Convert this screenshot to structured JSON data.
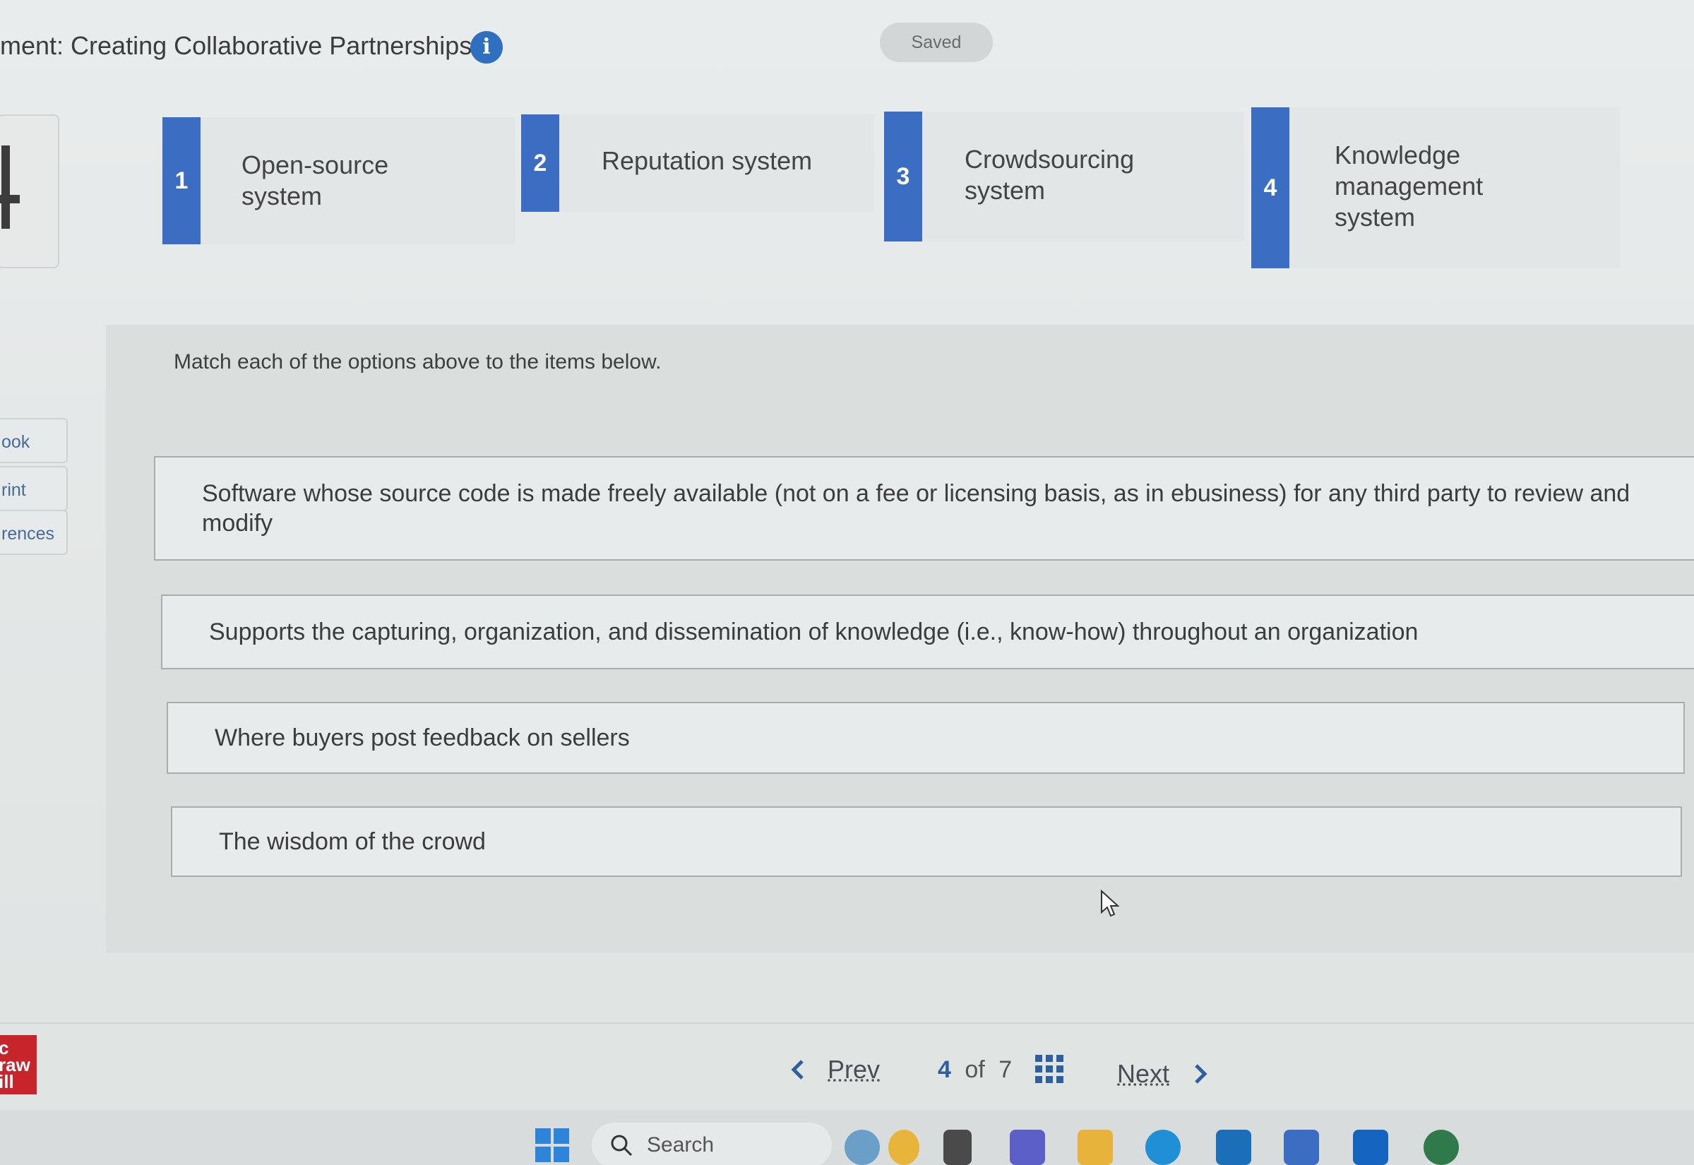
{
  "header": {
    "title": "ment: Creating Collaborative Partnerships",
    "saved_label": "Saved"
  },
  "side_tabs": [
    "ook",
    "rint",
    "rences"
  ],
  "options": [
    {
      "number": "1",
      "label": "Open-source system"
    },
    {
      "number": "2",
      "label": "Reputation system"
    },
    {
      "number": "3",
      "label": "Crowdsourcing system"
    },
    {
      "number": "4",
      "label": "Knowledge management system"
    }
  ],
  "instructions": "Match each of the options above to the items below.",
  "items": [
    "Software whose source code is made freely available (not on a fee or licensing basis, as in ebusiness) for any third party to review and modify",
    "Supports the capturing, organization, and dissemination of knowledge (i.e., know-how) throughout an organization",
    "Where buyers post feedback on sellers",
    "The wisdom of the crowd"
  ],
  "footer": {
    "logo_text": "c\nraw\nill",
    "prev_label": "Prev",
    "next_label": "Next",
    "current_page": "4",
    "of_label": "of",
    "total_pages": "7"
  },
  "taskbar": {
    "search_placeholder": "Search",
    "icons": [
      "widgets-icon",
      "file-explorer-icon",
      "teams-icon",
      "folder-icon",
      "edge-icon",
      "dell-icon",
      "store-icon",
      "outlook-icon",
      "app-icon"
    ]
  },
  "colors": {
    "accent_blue": "#3b6ec2",
    "logo_red": "#c8242c"
  }
}
